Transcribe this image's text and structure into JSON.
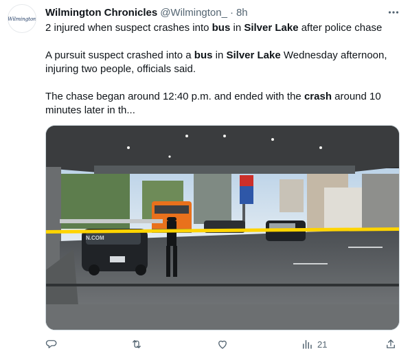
{
  "account": {
    "avatar_logo_text": "Wilmington",
    "name": "Wilmington Chronicles",
    "handle": "@Wilmington_",
    "separator": "·",
    "time": "8h"
  },
  "tweet": {
    "headline": [
      {
        "text": "2 injured when suspect crashes into ",
        "bold": false
      },
      {
        "text": "bus",
        "bold": true
      },
      {
        "text": " in ",
        "bold": false
      },
      {
        "text": "Silver Lake",
        "bold": true
      },
      {
        "text": " after police chase",
        "bold": false
      }
    ],
    "paragraph_one": [
      {
        "text": "A pursuit suspect crashed into a ",
        "bold": false
      },
      {
        "text": "bus",
        "bold": true
      },
      {
        "text": " in ",
        "bold": false
      },
      {
        "text": "Silver Lake",
        "bold": true
      },
      {
        "text": " Wednesday afternoon, injuring two people, officials said.",
        "bold": false
      }
    ],
    "paragraph_two": [
      {
        "text": "The chase began around 12:40 p.m. and ended with the ",
        "bold": false
      },
      {
        "text": "crash",
        "bold": true
      },
      {
        "text": " around 10 minutes later in th...",
        "bold": false
      }
    ]
  },
  "media": {
    "car_watermark": "N.COM"
  },
  "actions": {
    "reply_icon": "reply-icon",
    "retweet_icon": "retweet-icon",
    "like_icon": "heart-icon",
    "views_icon": "views-icon",
    "views_count": "21",
    "share_icon": "share-icon"
  },
  "colors": {
    "text": "#0f1419",
    "secondary": "#536471",
    "tape": "#ffd400",
    "bus": "#e9711c"
  }
}
